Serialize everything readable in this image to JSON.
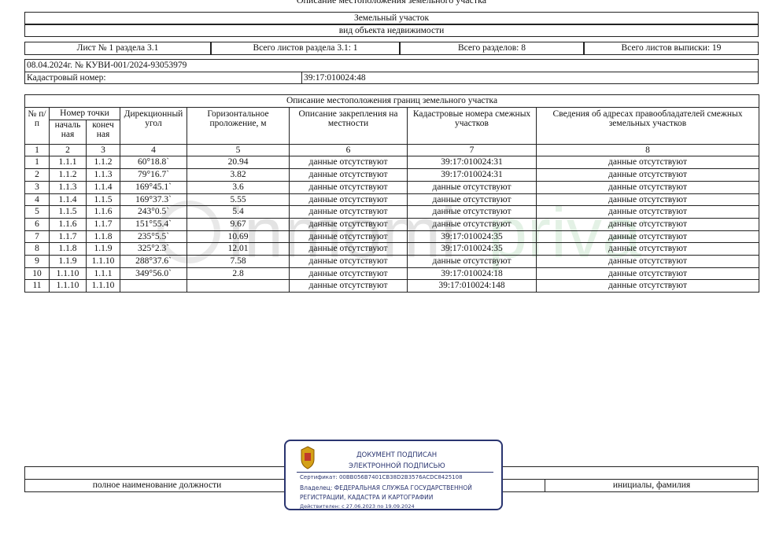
{
  "document": {
    "top_title": "Описание местоположения земельного участка",
    "object_type": "Земельный участок",
    "object_caption": "вид объекта недвижимости",
    "sheet_info": {
      "sheet": "Лист № 1 раздела 3.1",
      "sheets_in_section": "Всего листов раздела 3.1: 1",
      "sections_total": "Всего разделов: 8",
      "sheets_total": "Всего листов выписки: 19"
    },
    "date_number": "08.04.2024г. № КУВИ-001/2024-93053979",
    "cadastral_label": "Кадастровый номер:",
    "cadastral_number": "39:17:010024:48"
  },
  "table": {
    "title": "Описание местоположения границ земельного участка",
    "headers": {
      "num": "№ п/п",
      "point_number": "Номер точки",
      "start": "началь ная",
      "end": "конеч ная",
      "direction": "Дирекционный угол",
      "distance": "Горизонтальное проложение, м",
      "fixing": "Описание закрепления на местности",
      "cadastral": "Кадастровые номера смежных участков",
      "addresses": "Сведения об адресах правообладателей смежных земельных участков"
    },
    "col_numbers": [
      "1",
      "2",
      "3",
      "4",
      "5",
      "6",
      "7",
      "8"
    ],
    "rows": [
      {
        "n": "1",
        "start": "1.1.1",
        "end": "1.1.2",
        "angle": "60°18.8`",
        "dist": "20.94",
        "fix": "данные отсутствуют",
        "cad": "39:17:010024:31",
        "addr": "данные отсутствуют"
      },
      {
        "n": "2",
        "start": "1.1.2",
        "end": "1.1.3",
        "angle": "79°16.7`",
        "dist": "3.82",
        "fix": "данные отсутствуют",
        "cad": "39:17:010024:31",
        "addr": "данные отсутствуют"
      },
      {
        "n": "3",
        "start": "1.1.3",
        "end": "1.1.4",
        "angle": "169°45.1`",
        "dist": "3.6",
        "fix": "данные отсутствуют",
        "cad": "данные отсутствуют",
        "addr": "данные отсутствуют"
      },
      {
        "n": "4",
        "start": "1.1.4",
        "end": "1.1.5",
        "angle": "169°37.3`",
        "dist": "5.55",
        "fix": "данные отсутствуют",
        "cad": "данные отсутствуют",
        "addr": "данные отсутствуют"
      },
      {
        "n": "5",
        "start": "1.1.5",
        "end": "1.1.6",
        "angle": "243°0.5`",
        "dist": "5.4",
        "fix": "данные отсутствуют",
        "cad": "данные отсутствуют",
        "addr": "данные отсутствуют"
      },
      {
        "n": "6",
        "start": "1.1.6",
        "end": "1.1.7",
        "angle": "151°55.4`",
        "dist": "9.67",
        "fix": "данные отсутствуют",
        "cad": "данные отсутствуют",
        "addr": "данные отсутствуют"
      },
      {
        "n": "7",
        "start": "1.1.7",
        "end": "1.1.8",
        "angle": "235°5.5`",
        "dist": "10.69",
        "fix": "данные отсутствуют",
        "cad": "39:17:010024:35",
        "addr": "данные отсутствуют"
      },
      {
        "n": "8",
        "start": "1.1.8",
        "end": "1.1.9",
        "angle": "325°2.3`",
        "dist": "12.01",
        "fix": "данные отсутствуют",
        "cad": "39:17:010024:35",
        "addr": "данные отсутствуют"
      },
      {
        "n": "9",
        "start": "1.1.9",
        "end": "1.1.10",
        "angle": "288°37.6`",
        "dist": "7.58",
        "fix": "данные отсутствуют",
        "cad": "данные отсутствуют",
        "addr": "данные отсутствуют"
      },
      {
        "n": "10",
        "start": "1.1.10",
        "end": "1.1.1",
        "angle": "349°56.0`",
        "dist": "2.8",
        "fix": "данные отсутствуют",
        "cad": "39:17:010024:18",
        "addr": "данные отсутствуют"
      },
      {
        "n": "11",
        "start": "1.1.10",
        "end": "1.1.10",
        "angle": "",
        "dist": "",
        "fix": "данные отсутствуют",
        "cad": "39:17:010024:148",
        "addr": "данные отсутствуют"
      }
    ]
  },
  "watermark": "inmomi private",
  "signature": {
    "position_label": "полное наименование должности",
    "name_label": "инициалы, фамилия"
  },
  "stamp": {
    "line1": "ДОКУМЕНТ ПОДПИСАН",
    "line2": "ЭЛЕКТРОННОЙ ПОДПИСЬЮ",
    "certificate": "Сертификат: 00BB056B7401CB38D2B3576ACDC8425108",
    "owner_1": "Владелец: ФЕДЕРАЛЬНАЯ СЛУЖБА ГОСУДАРСТВЕННОЙ",
    "owner_2": "РЕГИСТРАЦИИ, КАДАСТРА И КАРТОГРАФИИ",
    "valid": "Действителен: с 27.06.2023 по 19.09.2024",
    "emblem_icon": "coat-of-arms-icon",
    "color": "#2a3570"
  }
}
